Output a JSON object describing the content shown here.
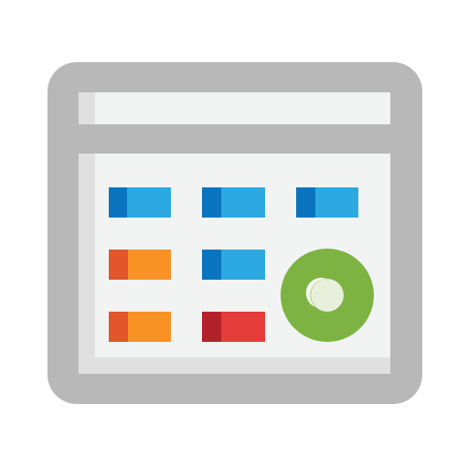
{
  "icon": {
    "name": "calendar-dashboard-icon",
    "frame_color": "#B8B8B8",
    "title_bar_fill": "#F2F3F3",
    "content_fill": "#F2F3F3",
    "shade_color": "#E0E0E0",
    "green_ring": "#7CB342",
    "ring_center": "#E8F0DC",
    "ring_highlight": "#F6F9F1",
    "tiles": [
      {
        "name": "tile-blue-1",
        "color": "#2BA9E0",
        "accent": "#0A74BE"
      },
      {
        "name": "tile-blue-2",
        "color": "#2BA9E0",
        "accent": "#0A74BE"
      },
      {
        "name": "tile-blue-3",
        "color": "#2BA9E0",
        "accent": "#0A74BE"
      },
      {
        "name": "tile-orange-1",
        "color": "#F89225",
        "accent": "#E3552A"
      },
      {
        "name": "tile-blue-4",
        "color": "#2BA9E0",
        "accent": "#0A74BE"
      },
      {
        "name": "tile-orange-2",
        "color": "#F89225",
        "accent": "#E3552A"
      },
      {
        "name": "tile-red-1",
        "color": "#E53D3B",
        "accent": "#B3212B"
      }
    ]
  }
}
